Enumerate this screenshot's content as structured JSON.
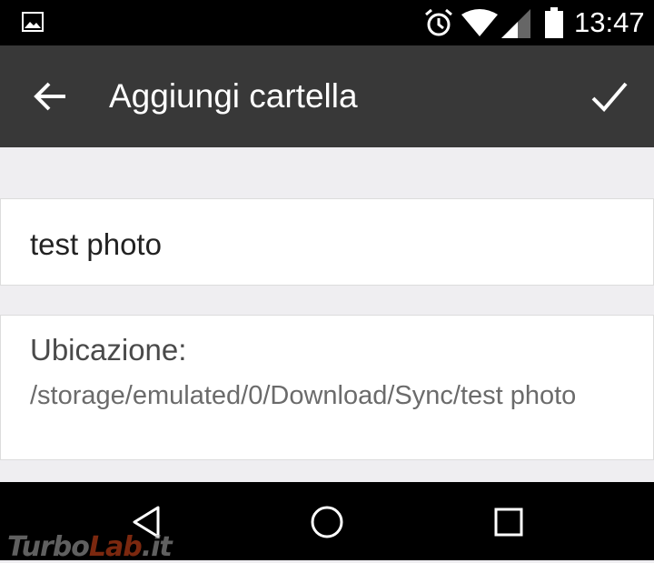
{
  "status_bar": {
    "time": "13:47",
    "icons": [
      "gallery-icon",
      "alarm-icon",
      "wifi-icon",
      "signal-icon",
      "battery-icon"
    ]
  },
  "app_bar": {
    "title": "Aggiungi cartella",
    "back_icon": "arrow-left-icon",
    "confirm_icon": "check-icon"
  },
  "form": {
    "folder_name_value": "test photo",
    "location_label": "Ubicazione:",
    "location_path": "/storage/emulated/0/Download/Sync/test photo"
  },
  "nav_bar": {
    "icons": [
      "back-triangle-icon",
      "home-circle-icon",
      "recents-square-icon"
    ]
  },
  "watermark": {
    "part1": "Turbo",
    "part2": "Lab",
    "part3": ".it"
  },
  "colors": {
    "app_bar": "#383838",
    "background": "#efeef1",
    "status_bar": "#000000"
  }
}
